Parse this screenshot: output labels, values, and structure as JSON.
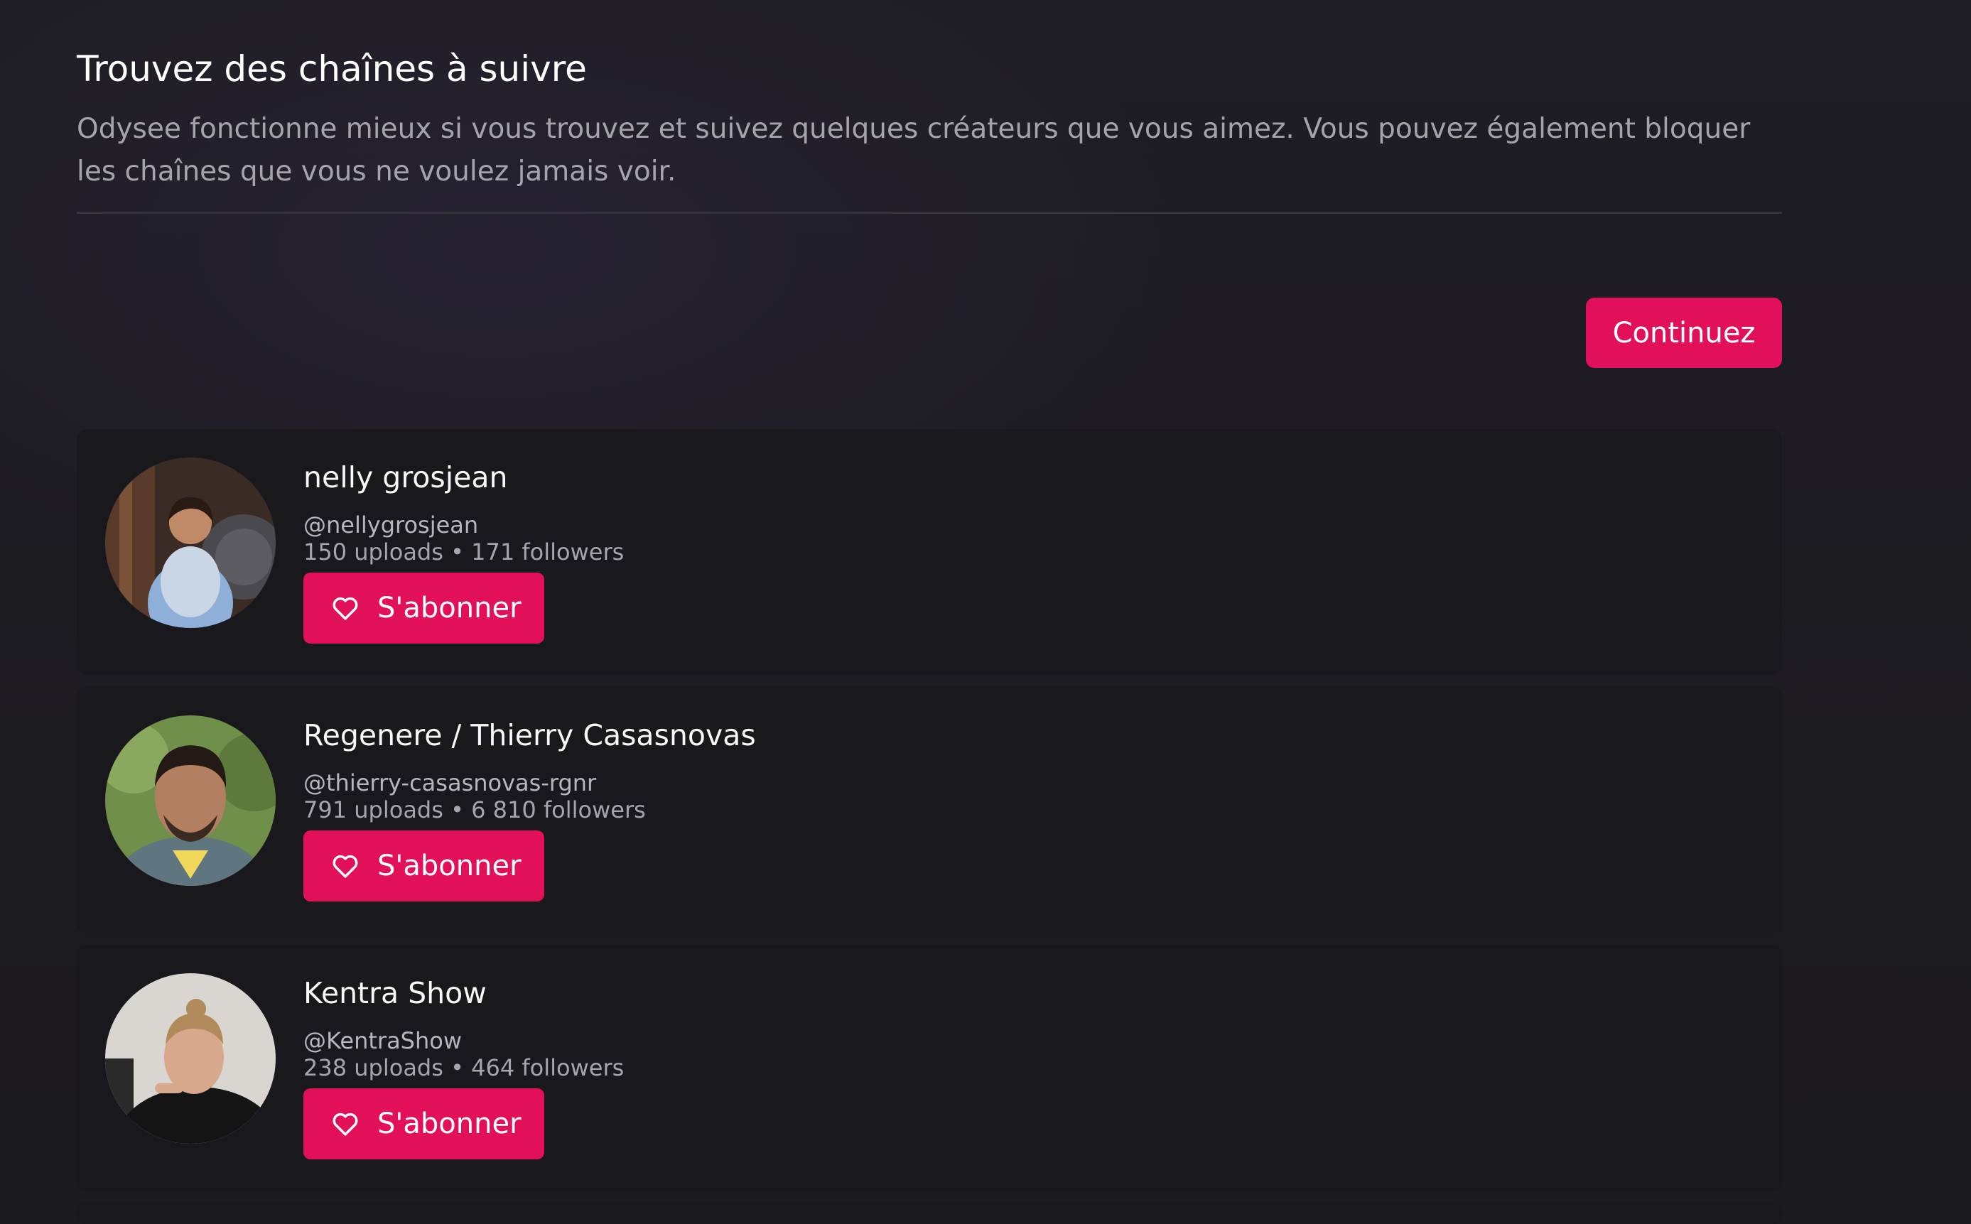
{
  "header": {
    "title": "Trouvez des chaînes à suivre",
    "subtitle": "Odysee fonctionne mieux si vous trouvez et suivez quelques créateurs que vous aimez. Vous pouvez également bloquer les chaînes que vous ne voulez jamais voir."
  },
  "actions": {
    "continue_label": "Continuez"
  },
  "channels": [
    {
      "name": "nelly grosjean",
      "handle": "@nellygrosjean",
      "stats": "150 uploads • 171 followers",
      "subscribe_label": "S'abonner"
    },
    {
      "name": "Regenere / Thierry Casasnovas",
      "handle": "@thierry-casasnovas-rgnr",
      "stats": "791 uploads • 6 810 followers",
      "subscribe_label": "S'abonner"
    },
    {
      "name": "Kentra Show",
      "handle": "@KentraShow",
      "stats": "238 uploads • 464 followers",
      "subscribe_label": "S'abonner"
    }
  ],
  "icons": {
    "subscribe": "heart-icon"
  },
  "colors": {
    "accent": "#e2105a",
    "background": "#1b1a1e",
    "card": "#19181d"
  }
}
